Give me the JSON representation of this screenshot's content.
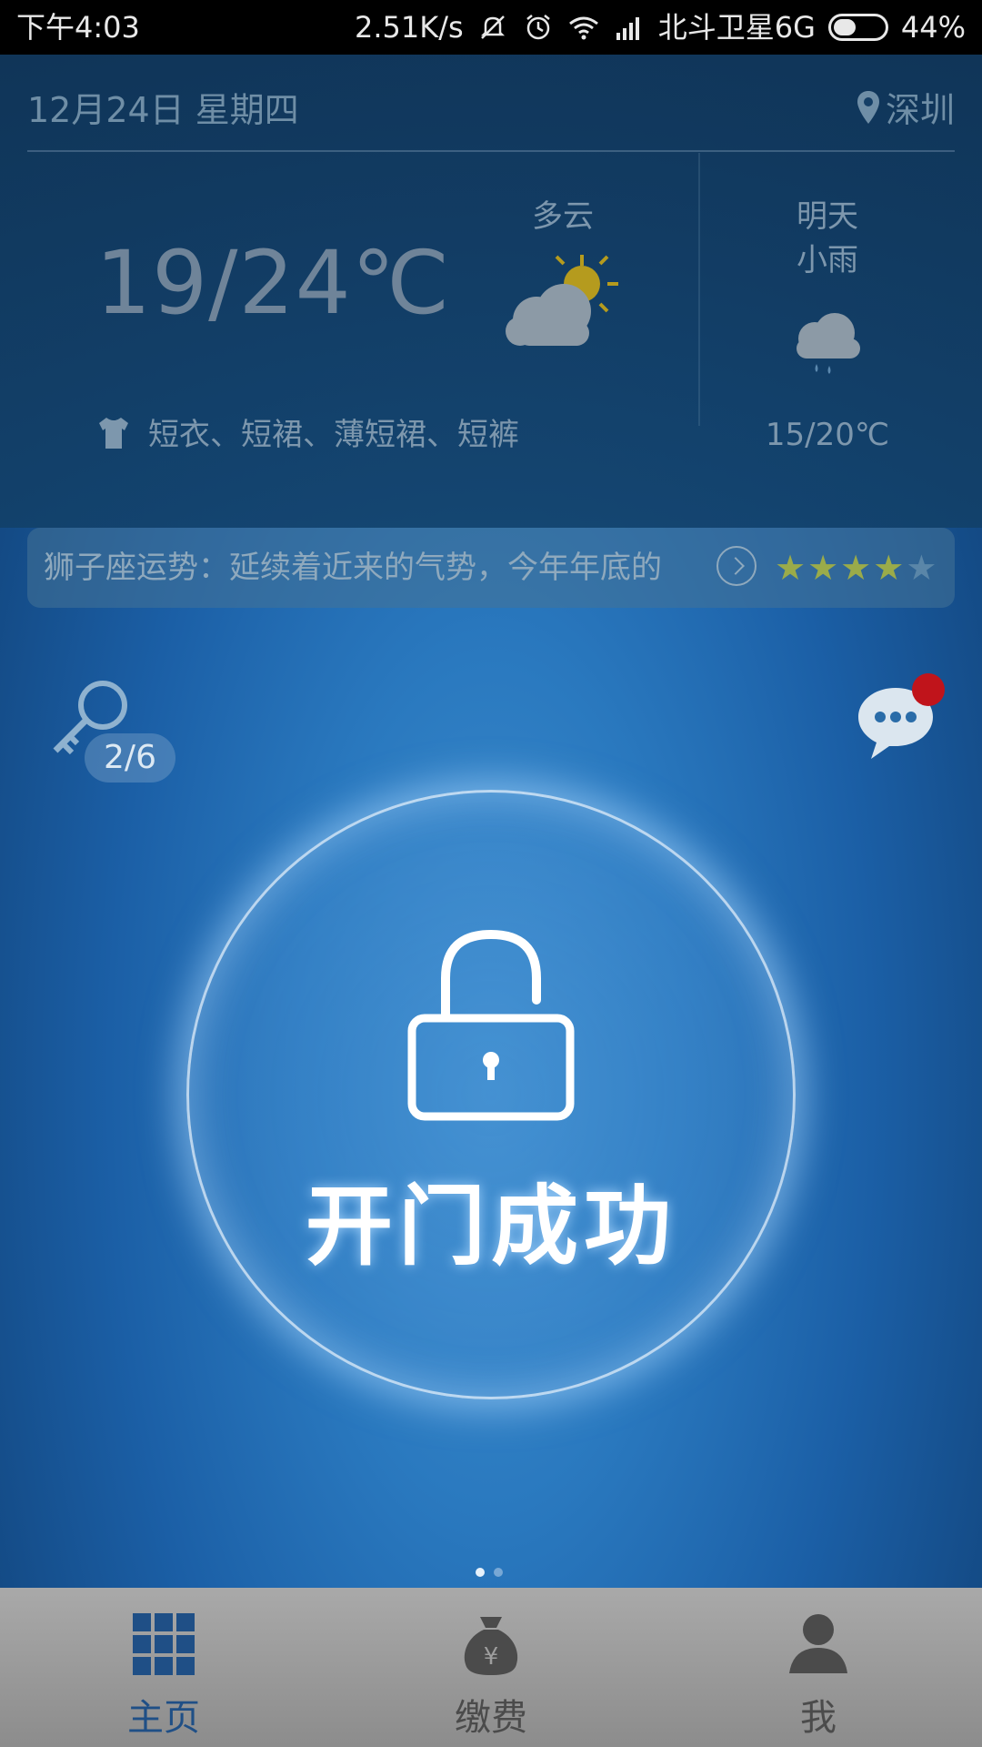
{
  "status_bar": {
    "time": "下午4:03",
    "speed": "2.51K/s",
    "carrier": "北斗卫星6G",
    "battery": "44%",
    "icons": [
      "mute-icon",
      "alarm-icon",
      "wifi-icon",
      "signal-icon",
      "battery-icon"
    ]
  },
  "weather": {
    "date": "12月24日 星期四",
    "location": "深圳",
    "today_temp": "19/24℃",
    "today_condition": "多云",
    "clothing": "短衣、短裙、薄短裙、短裤",
    "tomorrow_label": "明天",
    "tomorrow_condition": "小雨",
    "tomorrow_temp": "15/20℃"
  },
  "horoscope": {
    "text": "狮子座运势：延续着近来的气势，今年年底的",
    "stars_filled": 4,
    "stars_total": 5
  },
  "key": {
    "count": "2/6"
  },
  "unlock": {
    "status": "开门成功"
  },
  "pager": {
    "current": 1,
    "total": 2
  },
  "nav": {
    "items": [
      {
        "label": "主页",
        "icon": "grid-icon",
        "active": true
      },
      {
        "label": "缴费",
        "icon": "money-bag-icon",
        "active": false
      },
      {
        "label": "我",
        "icon": "person-icon",
        "active": false
      }
    ]
  },
  "colors": {
    "accent_active_nav": "#1f4f86",
    "notification_dot": "#c0141b",
    "star_on": "#9aab4a"
  }
}
